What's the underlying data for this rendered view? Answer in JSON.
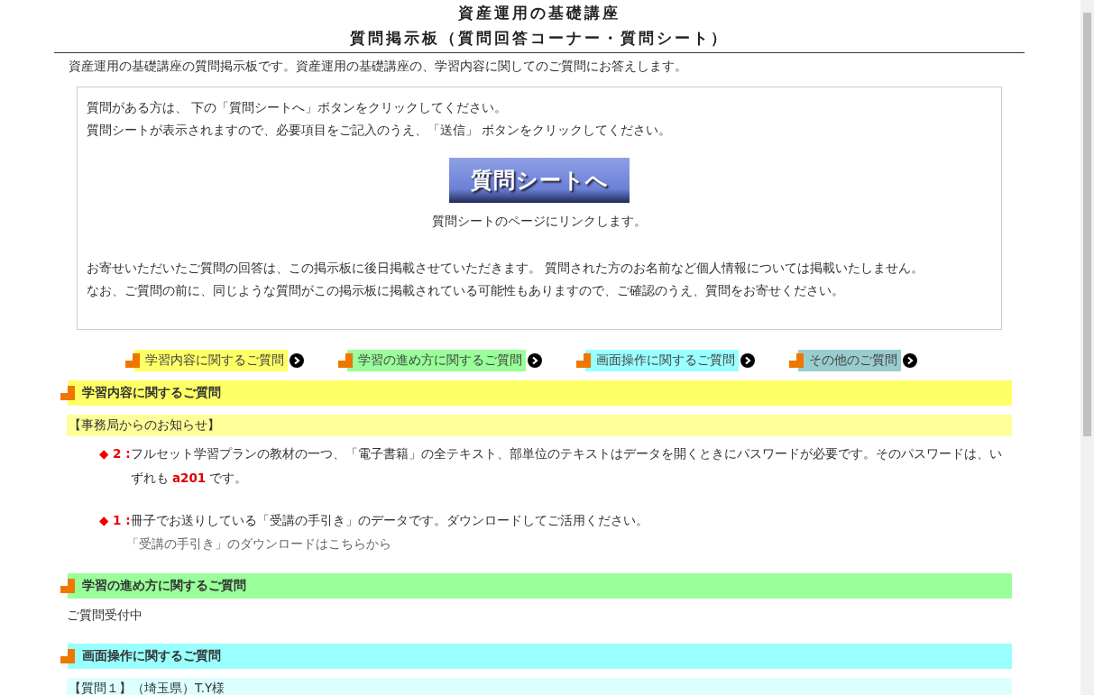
{
  "title_lines": [
    "資産運用の基礎講座",
    "質問掲示板（質問回答コーナー・質問シート）"
  ],
  "intro": "資産運用の基礎講座の質問掲示板です。資産運用の基礎講座の、学習内容に関してのご質問にお答えします。",
  "info_box": {
    "lines_top": [
      "質問がある方は、 下の「質問シートへ」ボタンをクリックしてください。",
      "質問シートが表示されますので、必要項目をご記入のうえ、「送信」 ボタンをクリックしてください。"
    ],
    "button": "質問シートへ",
    "button_caption": "質問シートのページにリンクします。",
    "lines_bottom": [
      "お寄せいただいたご質問の回答は、この掲示板に後日掲載させていただきます。 質問された方のお名前など個人情報については掲載いたしません。",
      "なお、ご質問の前に、同じような質問がこの掲示板に掲載されている可能性もありますので、ご確認のうえ、質問をお寄せください。"
    ]
  },
  "nav_links": [
    {
      "label": "学習内容に関するご質問",
      "color": "#ffff66"
    },
    {
      "label": "学習の進め方に関するご質問",
      "color": "#99ff99"
    },
    {
      "label": "画面操作に関するご質問",
      "color": "#99ffff"
    },
    {
      "label": "その他のご質問",
      "color": "#99cccc"
    }
  ],
  "sections": [
    {
      "title": "学習内容に関するご質問",
      "color": "#ffff66",
      "sub_heading": {
        "text": "【事務局からのお知らせ】",
        "color": "#ffff99"
      },
      "items": [
        {
          "label": "◆ 2 :",
          "text": "フルセット学習プランの教材の一つ、「電子書籍」の全テキスト、部単位のテキストはデータを開くときにパスワードが必要です。そのパスワードは、いずれも **a201** です。"
        },
        {
          "label": "◆ 1 :",
          "text": "冊子でお送りしている「受講の手引き」のデータです。ダウンロードしてご活用ください。",
          "link": "「受講の手引き」のダウンロードはこちらから"
        }
      ]
    },
    {
      "title": "学習の進め方に関するご質問",
      "color": "#99ff99",
      "body": "ご質問受付中"
    },
    {
      "title": "画面操作に関するご質問",
      "color": "#99ffff",
      "sub_heading": {
        "text": "【質問１】（埼玉県）T.Y様",
        "color": "#ddffff"
      }
    }
  ]
}
